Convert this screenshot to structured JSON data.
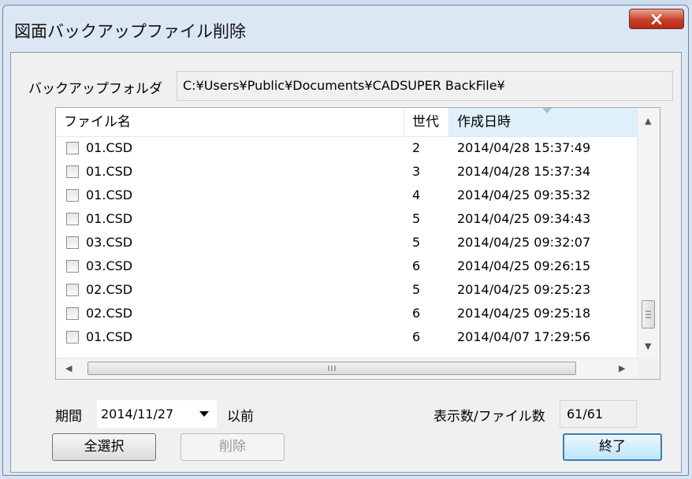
{
  "window": {
    "title": "図面バックアップファイル削除"
  },
  "backup_folder": {
    "label": "バックアップフォルダ",
    "path": "C:¥Users¥Public¥Documents¥CADSUPER BackFile¥"
  },
  "file_list": {
    "columns": [
      "ファイル名",
      "世代",
      "作成日時"
    ],
    "sorted_column": "作成日時",
    "rows": [
      {
        "name": "01.CSD",
        "gen": "2",
        "date": "2014/04/28 15:37:49",
        "checked": false
      },
      {
        "name": "01.CSD",
        "gen": "3",
        "date": "2014/04/28 15:37:34",
        "checked": false
      },
      {
        "name": "01.CSD",
        "gen": "4",
        "date": "2014/04/25 09:35:32",
        "checked": false
      },
      {
        "name": "01.CSD",
        "gen": "5",
        "date": "2014/04/25 09:34:43",
        "checked": false
      },
      {
        "name": "03.CSD",
        "gen": "5",
        "date": "2014/04/25 09:32:07",
        "checked": false
      },
      {
        "name": "03.CSD",
        "gen": "6",
        "date": "2014/04/25 09:26:15",
        "checked": false
      },
      {
        "name": "02.CSD",
        "gen": "5",
        "date": "2014/04/25 09:25:23",
        "checked": false
      },
      {
        "name": "02.CSD",
        "gen": "6",
        "date": "2014/04/25 09:25:18",
        "checked": false
      },
      {
        "name": "01.CSD",
        "gen": "6",
        "date": "2014/04/07 17:29:56",
        "checked": false
      }
    ]
  },
  "period": {
    "label": "期間",
    "value": "2014/11/27",
    "suffix": "以前"
  },
  "count": {
    "label": "表示数/ファイル数",
    "value": "61/61"
  },
  "buttons": {
    "select_all": "全選択",
    "delete": "削除",
    "exit": "終了"
  },
  "icons": {
    "close": "close-icon",
    "dropdown": "chevron-down-icon"
  },
  "colors": {
    "close_button": "#c8402a",
    "default_button_border": "#3c7fb1",
    "sorted_header": "#dff0fb"
  }
}
